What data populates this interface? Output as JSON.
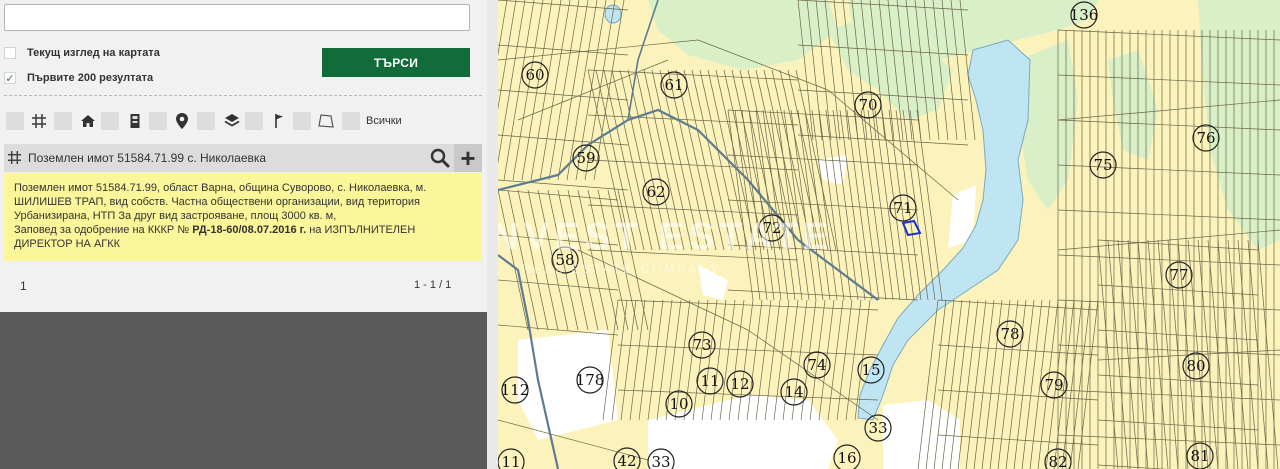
{
  "search": {
    "value": "",
    "placeholder": ""
  },
  "options": {
    "current_view_label": "Текущ изглед на картата",
    "current_view_checked": false,
    "first_200_label": "Първите 200 резултата",
    "first_200_checked": true
  },
  "search_button_label": "ТЪРСИ",
  "filters": {
    "icons": [
      "grid-icon",
      "home-icon",
      "building-icon",
      "location-pin-icon",
      "layers-icon",
      "flag-icon",
      "polygon-icon"
    ],
    "all_label": "Всички"
  },
  "result": {
    "title": "Поземлен имот 51584.71.99 с. Николаевка",
    "desc_part1": "Поземлен имот 51584.71.99, област Варна, община Суворово, с. Николаевка, м. ШИЛИШЕВ ТРАП, вид собств. Частна обществени организации, вид територия Урбанизирана, НТП За друг вид застрояване, площ 3000 кв. м,",
    "desc_part2": "Заповед за одобрение на КККР №",
    "order_ref": "РД-18-60/08.07.2016 г.",
    "desc_part3": "на ИЗПЪЛНИТЕЛЕН ДИРЕКТОР НА АГКК",
    "page": "1",
    "range": "1 - 1 / 1"
  },
  "map": {
    "watermark": "INVEST ESTATE",
    "watermark_sub": "REAL ESTATE COMPANY",
    "plot_labels": [
      "136",
      "60",
      "61",
      "70",
      "76",
      "75",
      "59",
      "62",
      "71",
      "72",
      "58",
      "77",
      "78",
      "73",
      "74",
      "15",
      "80",
      "79",
      "112",
      "178",
      "11",
      "12",
      "14",
      "10",
      "33",
      "16",
      "42",
      "33",
      "82",
      "81",
      "11"
    ],
    "colors": {
      "land": "#fbf3bb",
      "forest": "#d9efc8",
      "water": "#bfe5f2",
      "parcel_line": "#6b6648",
      "road": "#5d7c8f",
      "selected": "#1a2fd6"
    }
  }
}
